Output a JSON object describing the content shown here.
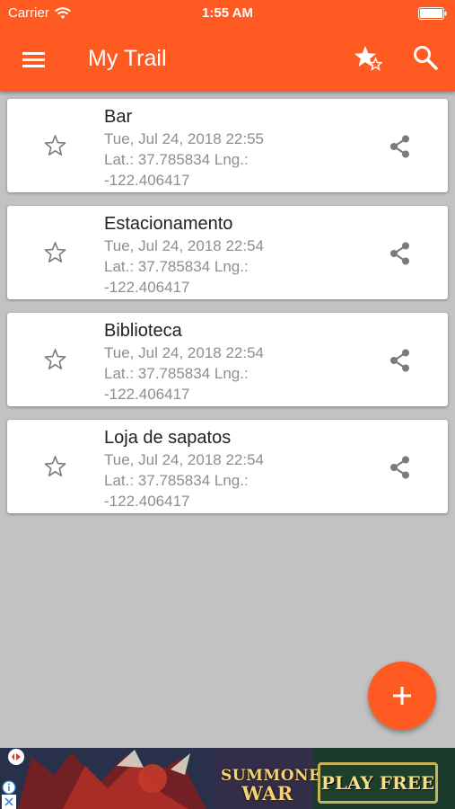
{
  "status_bar": {
    "carrier": "Carrier",
    "time": "1:55 AM",
    "icons": [
      "wifi-icon",
      "battery-icon"
    ]
  },
  "app_bar": {
    "title": "My Trail",
    "icons": [
      "menu-icon",
      "star-favorites-icon",
      "search-icon"
    ]
  },
  "trail_items": [
    {
      "name": "Bar",
      "date": "Tue, Jul 24, 2018 22:55",
      "coords_line1": "Lat.: 37.785834  Lng.:",
      "coords_line2": "-122.406417"
    },
    {
      "name": "Estacionamento",
      "date": "Tue, Jul 24, 2018 22:54",
      "coords_line1": "Lat.: 37.785834  Lng.:",
      "coords_line2": "-122.406417"
    },
    {
      "name": "Biblioteca",
      "date": "Tue, Jul 24, 2018 22:54",
      "coords_line1": "Lat.: 37.785834  Lng.:",
      "coords_line2": "-122.406417"
    },
    {
      "name": "Loja de sapatos",
      "date": "Tue, Jul 24, 2018 22:54",
      "coords_line1": "Lat.: 37.785834  Lng.:",
      "coords_line2": "-122.406417"
    }
  ],
  "fab": {
    "icon": "plus-icon"
  },
  "ad": {
    "logo_line1": "SUMMONERS",
    "logo_line2": "WAR",
    "cta": "PLAY FREE",
    "icons": [
      "info-icon",
      "close-icon"
    ]
  },
  "colors": {
    "accent": "#ff5a22",
    "background": "#c2c2c2",
    "card": "#ffffff",
    "primary_text": "#222222",
    "secondary_text": "#8e8e8e",
    "icon_gray": "#7a7a7a"
  }
}
